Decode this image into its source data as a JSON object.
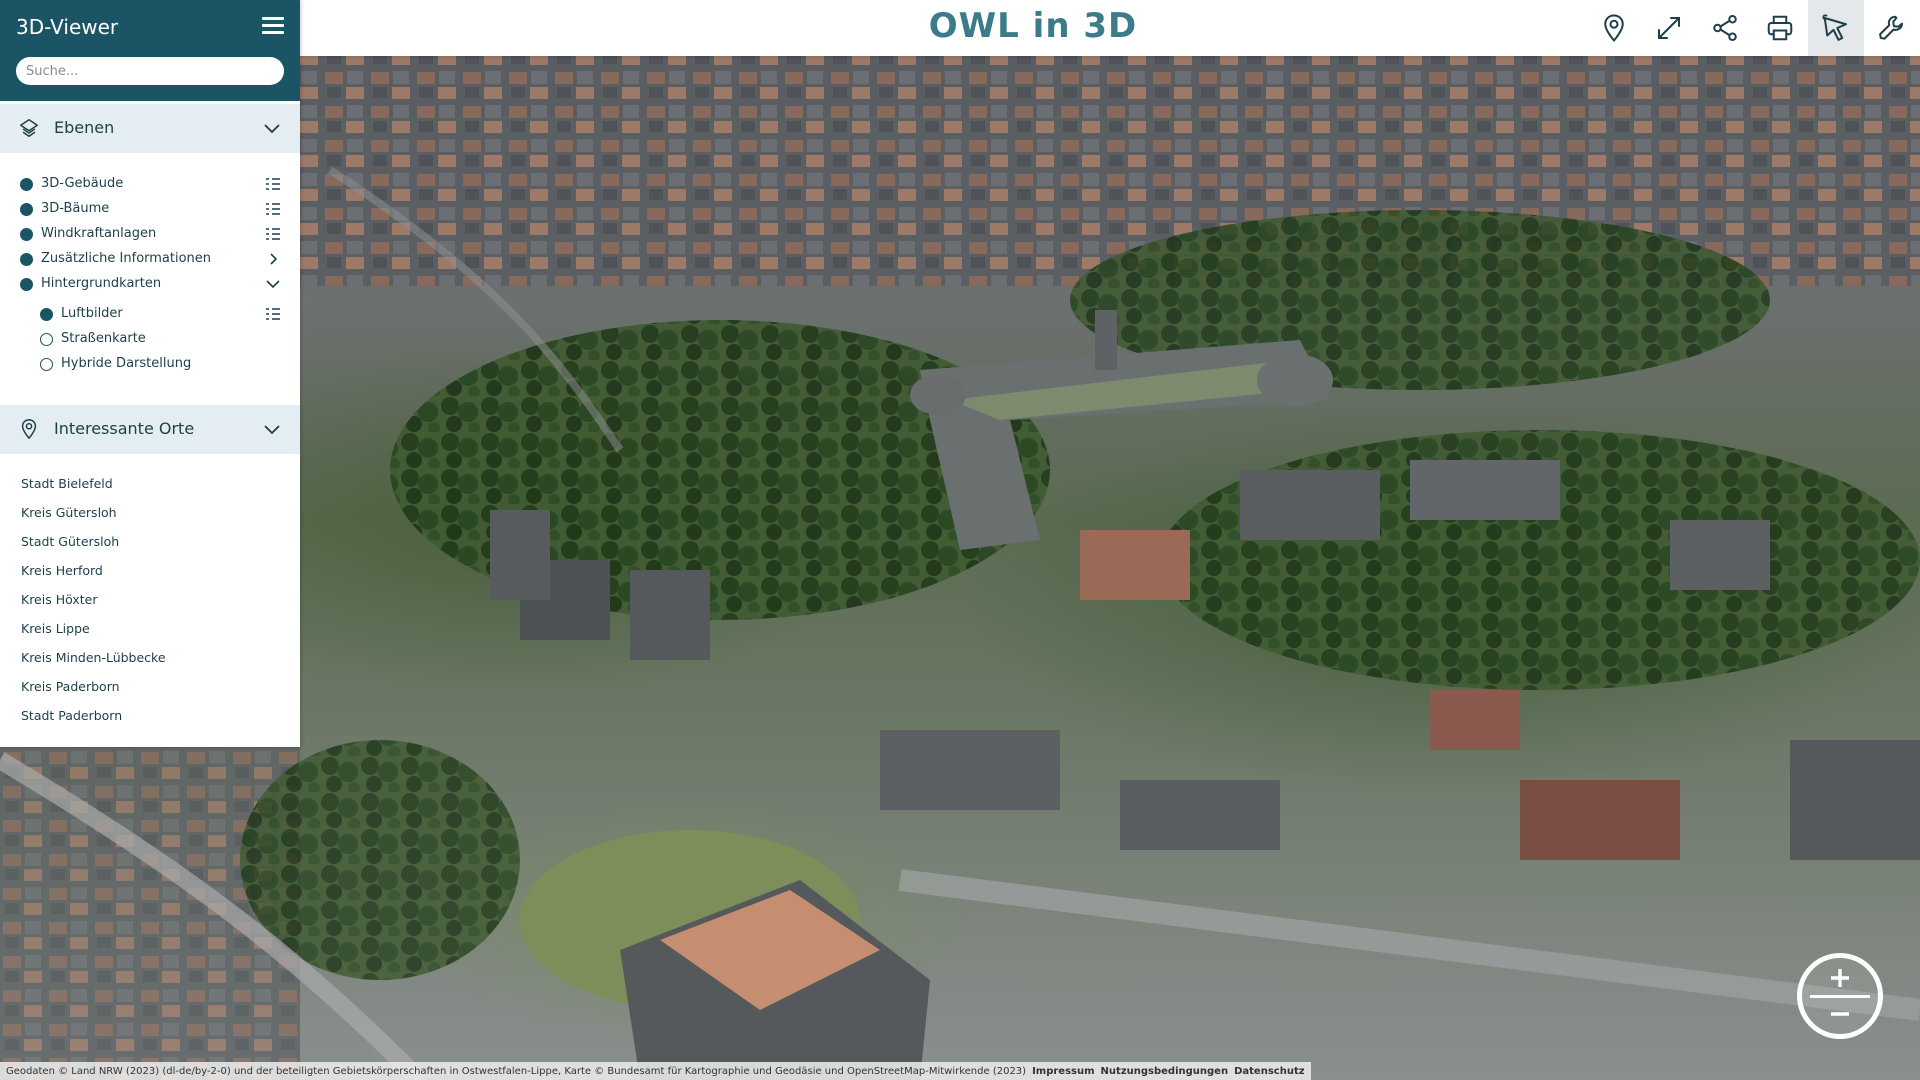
{
  "header": {
    "title": "OWL in 3D",
    "tools": [
      {
        "name": "location-pin-icon",
        "action": "Position"
      },
      {
        "name": "fullscreen-icon",
        "action": "Vollbild"
      },
      {
        "name": "share-icon",
        "action": "Teilen"
      },
      {
        "name": "print-icon",
        "action": "Drucken"
      },
      {
        "name": "select-cursor-icon",
        "action": "Auswahl",
        "active": true
      },
      {
        "name": "wrench-icon",
        "action": "Werkzeuge"
      }
    ]
  },
  "sidebar": {
    "title": "3D-Viewer",
    "search": {
      "placeholder": "Suche...",
      "value": ""
    },
    "layers_section": {
      "label": "Ebenen",
      "items": [
        {
          "label": "3D-Gebäude",
          "active": true,
          "tail": "list-icon"
        },
        {
          "label": "3D-Bäume",
          "active": true,
          "tail": "list-icon"
        },
        {
          "label": "Windkraftanlagen",
          "active": true,
          "tail": "list-icon"
        },
        {
          "label": "Zusätzliche Informationen",
          "active": true,
          "tail": "chevron-right-icon"
        },
        {
          "label": "Hintergrundkarten",
          "active": true,
          "tail": "chevron-down-icon"
        }
      ],
      "basemaps": [
        {
          "label": "Luftbilder",
          "active": true,
          "tail": "list-icon"
        },
        {
          "label": "Straßenkarte",
          "active": false
        },
        {
          "label": "Hybride Darstellung",
          "active": false
        }
      ]
    },
    "places_section": {
      "label": "Interessante Orte",
      "items": [
        "Stadt Bielefeld",
        "Kreis Gütersloh",
        "Stadt Gütersloh",
        "Kreis Herford",
        "Kreis Höxter",
        "Kreis Lippe",
        "Kreis Minden-Lübbecke",
        "Kreis Paderborn",
        "Stadt Paderborn"
      ]
    }
  },
  "footer": {
    "attribution": "Geodaten © Land NRW (2023) (dl-de/by-2-0) und der beteiligten Gebietskörperschaften in Ostwestfalen-Lippe, Karte © Bundesamt für Kartographie und Geodäsie und OpenStreetMap-Mitwirkende (2023)",
    "links": [
      "Impressum",
      "Nutzungsbedingungen",
      "Datenschutz"
    ]
  },
  "colors": {
    "sidebar_header": "#1b5565",
    "section_head": "#e4eef2",
    "title_accent": "#3c7c8a",
    "text_dark": "#1d3f4a"
  }
}
